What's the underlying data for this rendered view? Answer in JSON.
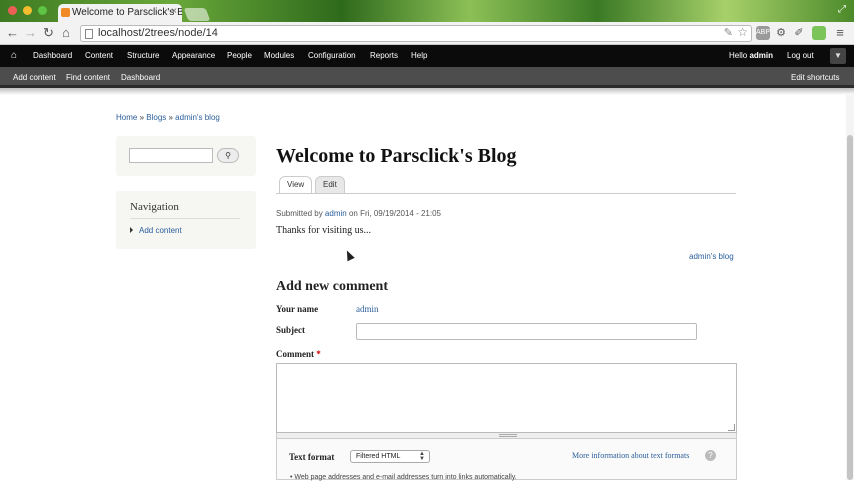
{
  "browser": {
    "tab_title": "Welcome to Parsclick's Blog",
    "tab_close": "×",
    "url": "localhost/2trees/node/14",
    "nav_back": "←",
    "nav_forward": "→",
    "nav_reload": "↻",
    "nav_home": "⌂",
    "star": "☆",
    "settings": "⚙",
    "menu": "≡"
  },
  "admin_toolbar": {
    "items": [
      "Dashboard",
      "Content",
      "Structure",
      "Appearance",
      "People",
      "Modules",
      "Configuration",
      "Reports",
      "Help"
    ],
    "greeting": "Hello ",
    "username": "admin",
    "logout": "Log out",
    "toggle": "▼"
  },
  "shortcuts": {
    "items": [
      "Add content",
      "Find content",
      "Dashboard"
    ],
    "edit": "Edit shortcuts"
  },
  "breadcrumb": {
    "home": "Home",
    "sep": " » ",
    "blogs": "Blogs",
    "current": "admin's blog"
  },
  "search": {
    "button_icon": "🔍"
  },
  "navigation": {
    "title": "Navigation",
    "items": [
      "Add content"
    ]
  },
  "node": {
    "title": "Welcome to Parsclick's Blog",
    "tabs": [
      "View",
      "Edit"
    ],
    "submitted_prefix": "Submitted by ",
    "author": "admin",
    "submitted_suffix": " on Fri, 09/19/2014 - 21:05",
    "body": "Thanks for visiting us...",
    "blog_link": "admin's blog"
  },
  "comment_form": {
    "title": "Add new comment",
    "your_name_label": "Your name",
    "your_name_value": "admin",
    "subject_label": "Subject",
    "comment_label": "Comment",
    "required_mark": "*",
    "text_format_label": "Text format",
    "text_format_value": "Filtered HTML",
    "more_info": "More information about text formats",
    "help_icon": "?",
    "tip": "Web page addresses and e-mail addresses turn into links automatically."
  }
}
